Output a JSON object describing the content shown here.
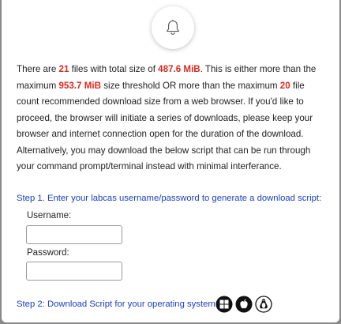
{
  "icons": {
    "bell": "bell-icon",
    "windows": "windows-icon",
    "apple": "apple-icon",
    "linux": "linux-icon"
  },
  "colors": {
    "highlight": "#e0281e",
    "step_text": "#1a3fbf"
  },
  "message": {
    "p1": "There are ",
    "file_count": "21",
    "p2": " files with total size of ",
    "total_size": "487.6 MiB",
    "p3": ". This is either more than the maximum ",
    "size_threshold": "953.7 MiB",
    "p4": " size threshold OR more than the maximum ",
    "count_threshold": "20",
    "p5": " file count recommended download size from a web browser. If you'd like to proceed, the browser will initiate a series of downloads, please keep your browser and internet connection open for the duration of the download. Alternatively, you may download the below script that can be run through your command prompt/terminal instead with minimal interferance."
  },
  "step1": {
    "label": "Step 1. Enter your labcas username/password to generate a download script:"
  },
  "form": {
    "username_label": "Username:",
    "username_value": "",
    "password_label": "Password:",
    "password_value": ""
  },
  "step2": {
    "label": "Step 2: Download Script for your operating system:"
  }
}
